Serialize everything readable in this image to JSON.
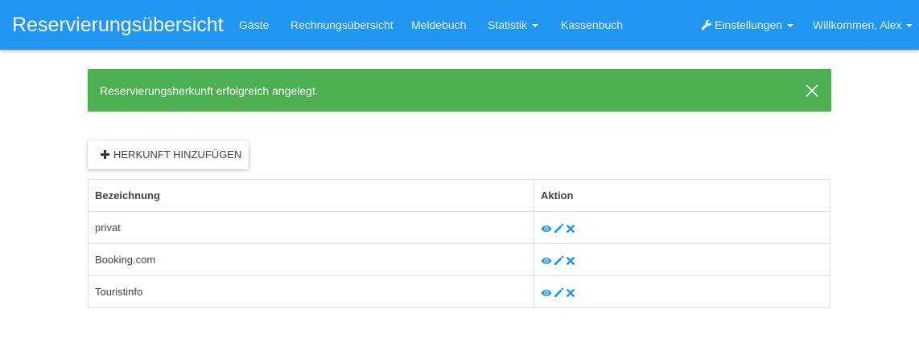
{
  "navbar": {
    "brand": "Reservierungsübersicht",
    "items": [
      {
        "label": "Gäste"
      },
      {
        "label": "Rechnungsübersicht"
      },
      {
        "label": "Meldebuch"
      },
      {
        "label": "Statistik"
      },
      {
        "label": "Kassenbuch"
      }
    ],
    "settings_label": "Einstellungen",
    "user_label": "Willkommen, Alex"
  },
  "alert": {
    "message": "Reservierungsherkunft erfolgreich angelegt.",
    "color": "#4caf50"
  },
  "add_button": {
    "label": "HERKUNFT HINZUFÜGEN",
    "icon": "plus-icon"
  },
  "table": {
    "headers": [
      "Bezeichnung",
      "Aktion"
    ],
    "rows": [
      {
        "name": "privat"
      },
      {
        "name": "Booking.com"
      },
      {
        "name": "Touristinfo"
      }
    ],
    "action_icons": [
      "eye-icon",
      "pencil-icon",
      "close-icon"
    ]
  },
  "colors": {
    "primary": "#2196f3",
    "success": "#4caf50"
  }
}
